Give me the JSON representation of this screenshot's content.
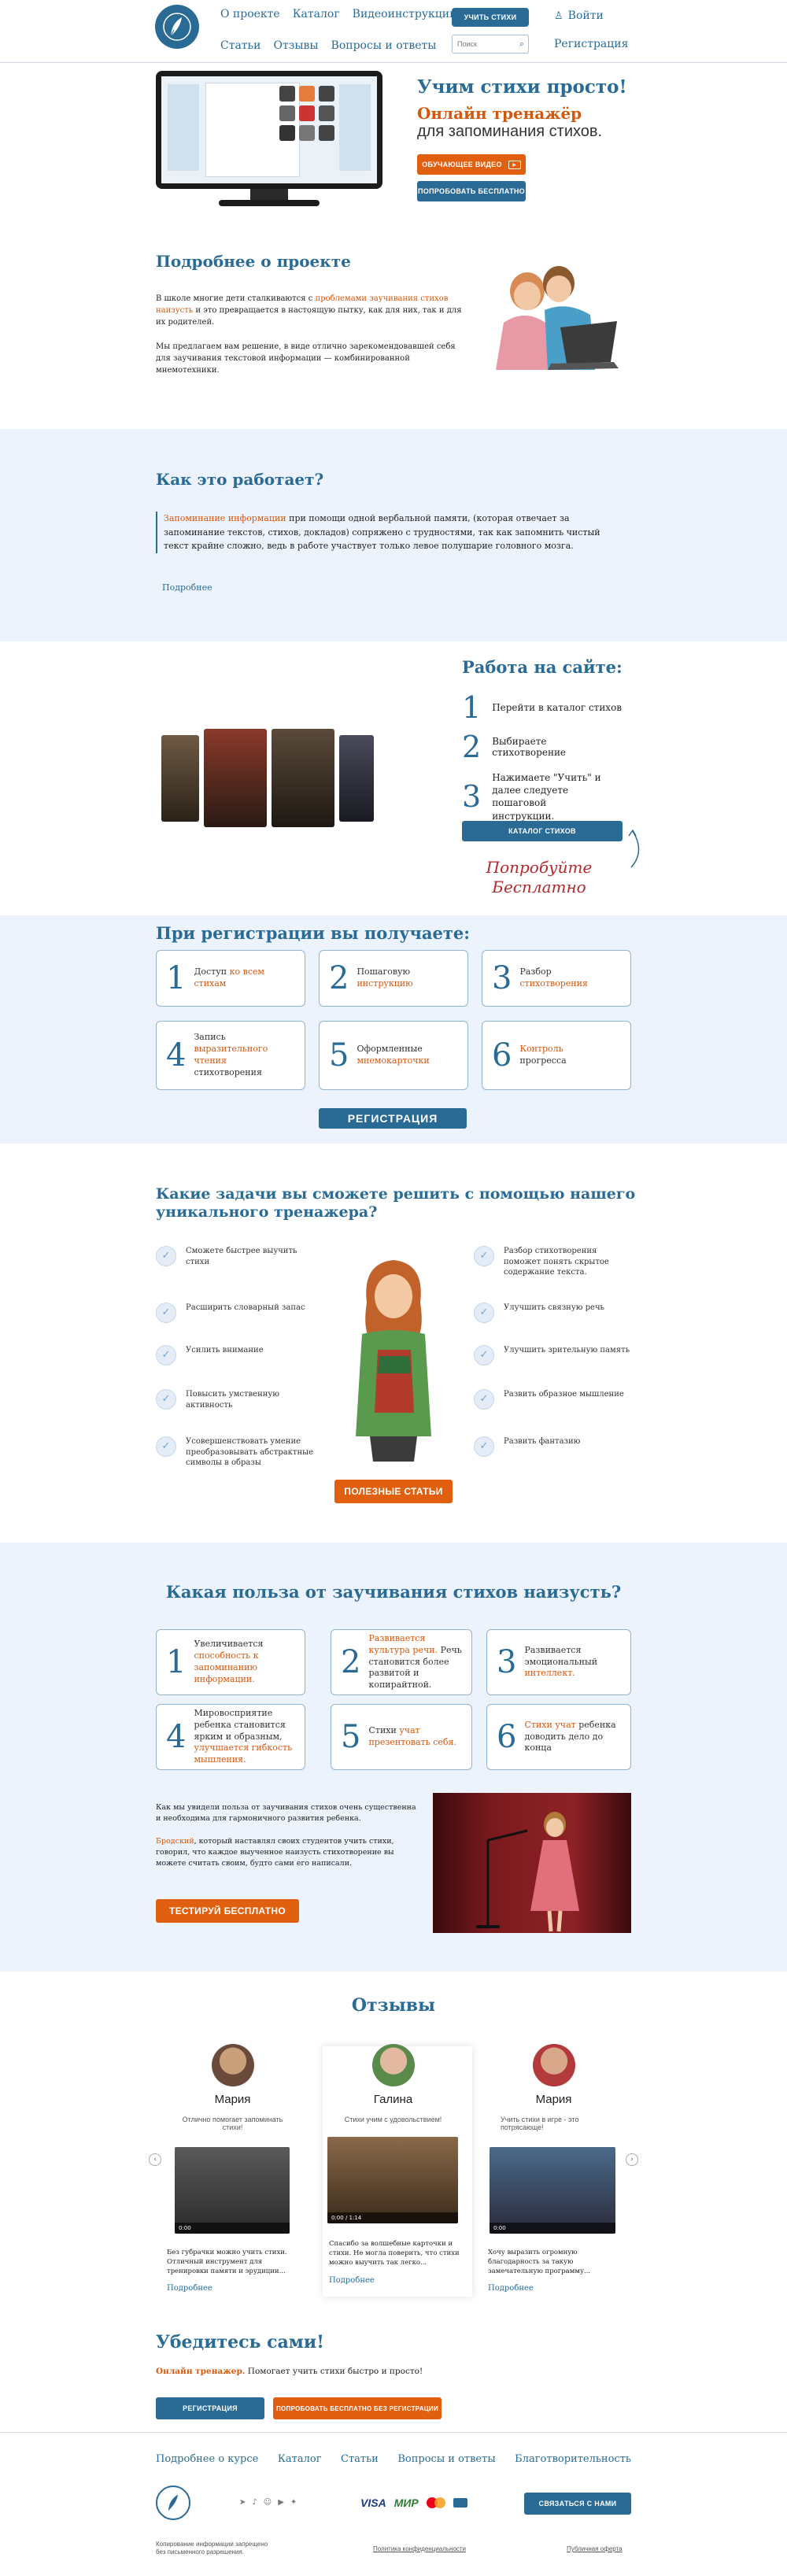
{
  "header": {
    "nav_row1": [
      "О проекте",
      "Каталог",
      "Видеоинструкции"
    ],
    "nav_row2": [
      "Статьи",
      "Отзывы",
      "Вопросы и ответы"
    ],
    "teach_button": "Учить стихи",
    "search_placeholder": "Поиск",
    "login": "Войти",
    "register": "Регистрация"
  },
  "hero": {
    "title": "Учим стихи просто!",
    "subtitle_accent": "Онлайн тренажёр",
    "subtitle": "для запоминания стихов.",
    "video_button": "Обучающее видео",
    "try_button": "Попробовать бесплатно"
  },
  "about": {
    "title": "Подробнее о проекте",
    "p1_a": "В школе многие дети сталкиваются с ",
    "p1_link": "проблемами заучивания стихов наизусть",
    "p1_b": " и это превращается в настоящую пытку, как для них, так и для их родителей.",
    "p2": "Мы предлагаем вам решение, в виде отлично зарекомендовавшей себя для заучивания текстовой информации — комбинированной мнемотехники."
  },
  "how": {
    "title": "Как это работает?",
    "quote_link": "Запоминание информации",
    "quote_text": " при помощи одной вербальной памяти, (которая отвечает за запоминание текстов, стихов, докладов) сопряжено с трудностями, так как запомнить чистый текст крайне сложно, ведь в работе участвует только левое полушарие головного мозга.",
    "more": "Подробнее"
  },
  "work": {
    "title": "Работа на сайте:",
    "steps": [
      {
        "n": "1",
        "text": "Перейти в каталог стихов"
      },
      {
        "n": "2",
        "text": "Выбираете стихотворение"
      },
      {
        "n": "3",
        "text": "Нажимаете \"Учить\" и далее следуете пошаговой инструкции."
      }
    ],
    "catalog_button": "Каталог стихов",
    "try_free_1": "Попробуйте",
    "try_free_2": "Бесплатно"
  },
  "benefits": {
    "title": "При регистрации вы получаете:",
    "cards": [
      {
        "n": "1",
        "a": "Доступ ",
        "b": "ко всем стихам",
        "c": ""
      },
      {
        "n": "2",
        "a": "Пошаговую ",
        "b": "инструкцию",
        "c": ""
      },
      {
        "n": "3",
        "a": "Разбор ",
        "b": "стихотворения",
        "c": ""
      },
      {
        "n": "4",
        "a": "Запись ",
        "b": "выразительного чтения",
        "c": " стихотворения"
      },
      {
        "n": "5",
        "a": "Оформленные ",
        "b": "мнемокарточки",
        "c": ""
      },
      {
        "n": "6",
        "a": "",
        "b": "Контроль",
        "c": " прогресса"
      }
    ],
    "register_button": "Регистрация"
  },
  "tasks": {
    "title_1": "Какие задачи вы сможете решить с помощью нашего",
    "title_2": "уникального тренажера?",
    "left": [
      "Сможете быстрее выучить стихи",
      "Расширить словарный запас",
      "Усилить внимание",
      "Повысить умственную активность",
      "Усовершенствовать умение преобразовывать абстрактные символы в образы"
    ],
    "right": [
      "Разбор стихотворения поможет понять скрытое содержание текста.",
      "Улучшить связную речь",
      "Улучшить зрительную память",
      "Развить образное мышление",
      "Развить фантазию"
    ],
    "articles_button": "Полезные статьи"
  },
  "usefulness": {
    "title": "Какая польза от заучивания стихов наизусть?",
    "cards": [
      {
        "n": "1",
        "a": "Увеличивается ",
        "b": "способность к запоминанию информации.",
        "c": ""
      },
      {
        "n": "2",
        "a": "",
        "b": "Развивается культура речи.",
        "c": " Речь становится более развитой и копирайтной."
      },
      {
        "n": "3",
        "a": "Развивается эмоциональный ",
        "b": "интеллект.",
        "c": ""
      },
      {
        "n": "4",
        "a": "Мировосприятие ребенка становится ярким и образным, ",
        "b": "улучшается гибкость мышления.",
        "c": ""
      },
      {
        "n": "5",
        "a": "Стихи ",
        "b": "учат презентовать себя.",
        "c": ""
      },
      {
        "n": "6",
        "a": "",
        "b": "Стихи учат",
        "c": " ребенка доводить дело до конца"
      }
    ],
    "p1": "Как мы увидели польза от заучивания стихов очень существенна и необходима для гармоничного развития ребенка.",
    "p2_link": "Бродский",
    "p2": ", который наставлял своих студентов учить стихи, говорил, что каждое выученное наизусть стихотворение вы можете считать своим, будто сами его написали.",
    "test_button": "Тестируй бесплатно"
  },
  "reviews": {
    "title": "Отзывы",
    "items": [
      {
        "name": "Мария",
        "lead": "Отлично помогает запоминать стихи!",
        "time": "0:00",
        "body": "Без губрачки можно учить стихи. Отличный инструмент для тренировки памяти и эрудиции...",
        "more": "Подробнее"
      },
      {
        "name": "Галина",
        "lead": "Стихи учим с удовольствием!",
        "time": "0:00 / 1:14",
        "body": "Спасибо за волшебные карточки и стихи. Не могла поверить, что стихи можно выучить так легко...",
        "more": "Подробнее"
      },
      {
        "name": "Мария",
        "lead": "Учить стихи в игре - это потрясающе!",
        "time": "0:00",
        "body": "Хочу выразить огромную благодарность за такую замечательную программу...",
        "more": "Подробнее"
      }
    ]
  },
  "convince": {
    "title": "Убедитесь сами!",
    "accent": "Онлайн тренажер.",
    "text": " Помогает учить стихи быстро и просто!",
    "register_button": "Регистрация",
    "try_button": "Попробовать бесплатно без регистрации"
  },
  "footer": {
    "links": [
      "Подробнее о курсе",
      "Каталог",
      "Статьи",
      "Вопросы и ответы",
      "Благотворительность"
    ],
    "payments": [
      "VISA",
      "МИР"
    ],
    "contact_button": "Связаться с нами",
    "copyright": "Копирование информации запрещено без письменного разрешения.",
    "privacy": "Политика конфиденциальности",
    "offer": "Публичная оферта"
  }
}
